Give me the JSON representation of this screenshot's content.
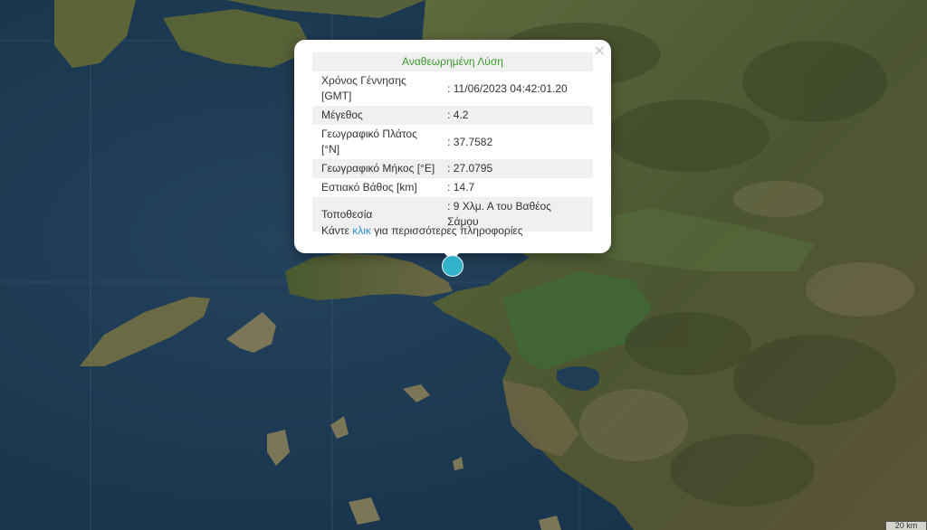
{
  "popup": {
    "title": "Αναθεωρημένη Λύση",
    "close_glyph": "×",
    "rows": [
      {
        "label": "Χρόνος Γέννησης [GMT]",
        "value": ": 11/06/2023 04:42:01.20"
      },
      {
        "label": "Μέγεθος",
        "value": ": 4.2"
      },
      {
        "label": "Γεωγραφικό Πλάτος [°N]",
        "value": ": 37.7582"
      },
      {
        "label": "Γεωγραφικό Μήκος [°E]",
        "value": ": 27.0795"
      },
      {
        "label": "Εστιακό Βάθος [km]",
        "value": ": 14.7"
      },
      {
        "label": "Τοποθεσία",
        "value": ": 9 Χλμ. Α του Βαθέος Σάμου"
      }
    ],
    "more_prefix": "Κάντε",
    "more_link": "κλικ",
    "more_suffix": "για περισσότερες πληροφορίες"
  },
  "map": {
    "scale_label": "20 km",
    "marker_icon": "earthquake-epicenter-marker",
    "colors": {
      "sea": "#1d3a52",
      "land": "#4f5a34",
      "marker": "#33b3c9",
      "title": "#3a9a2c",
      "link": "#2c8fce"
    }
  }
}
